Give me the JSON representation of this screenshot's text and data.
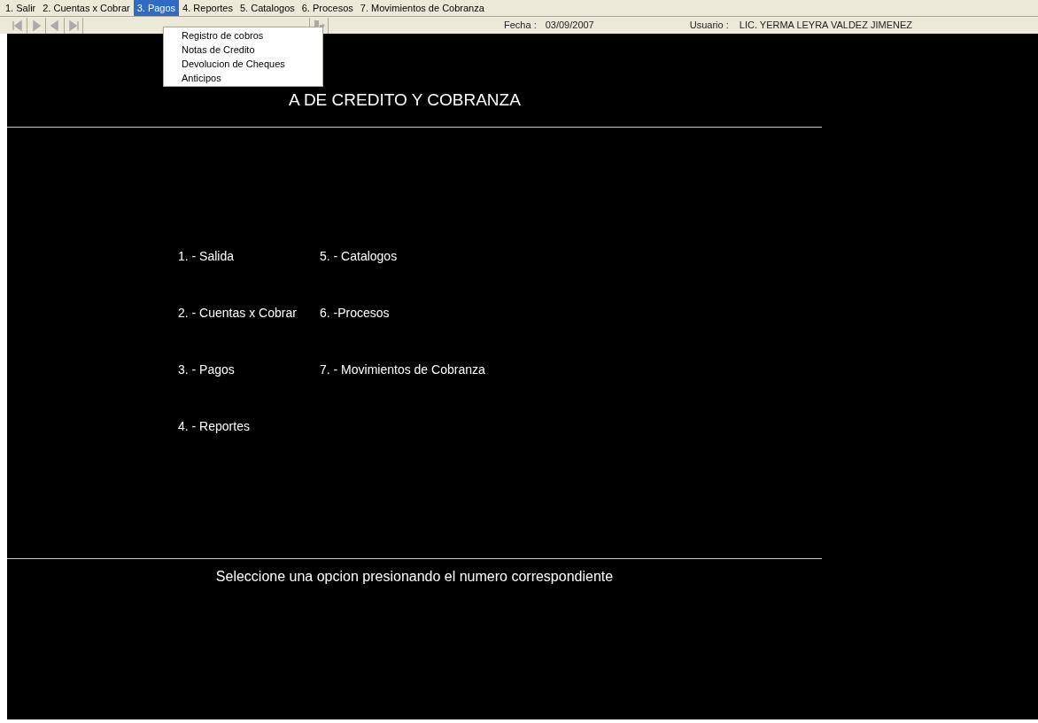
{
  "menu_bar": [
    {
      "label": "1. Salir",
      "selected": false
    },
    {
      "label": "2. Cuentas x Cobrar",
      "selected": false
    },
    {
      "label": "3. Pagos",
      "selected": true
    },
    {
      "label": "4. Reportes",
      "selected": false
    },
    {
      "label": "5. Catalogos",
      "selected": false
    },
    {
      "label": "6. Procesos",
      "selected": false
    },
    {
      "label": "7. Movimientos de Cobranza",
      "selected": false
    }
  ],
  "dropdown": {
    "items": [
      "Registro de cobros",
      "Notas de Credito",
      "Devolucion de Cheques",
      "Anticipos"
    ]
  },
  "toolbar": {
    "fecha_label": "Fecha :",
    "fecha": "03/09/2007",
    "usuario_label": "Usuario :",
    "usuario": "LIC. YERMA LEYRA VALDEZ JIMENEZ"
  },
  "main": {
    "title": "A DE CREDITO Y COBRANZA",
    "options_left": [
      "1. - Salida",
      "2. - Cuentas x Cobrar",
      "3. - Pagos",
      "4. - Reportes"
    ],
    "options_right": [
      "5. - Catalogos",
      "6. -Procesos",
      "7. - Movimientos de Cobranza"
    ],
    "footer": "Seleccione una opcion presionando el numero correspondiente"
  }
}
